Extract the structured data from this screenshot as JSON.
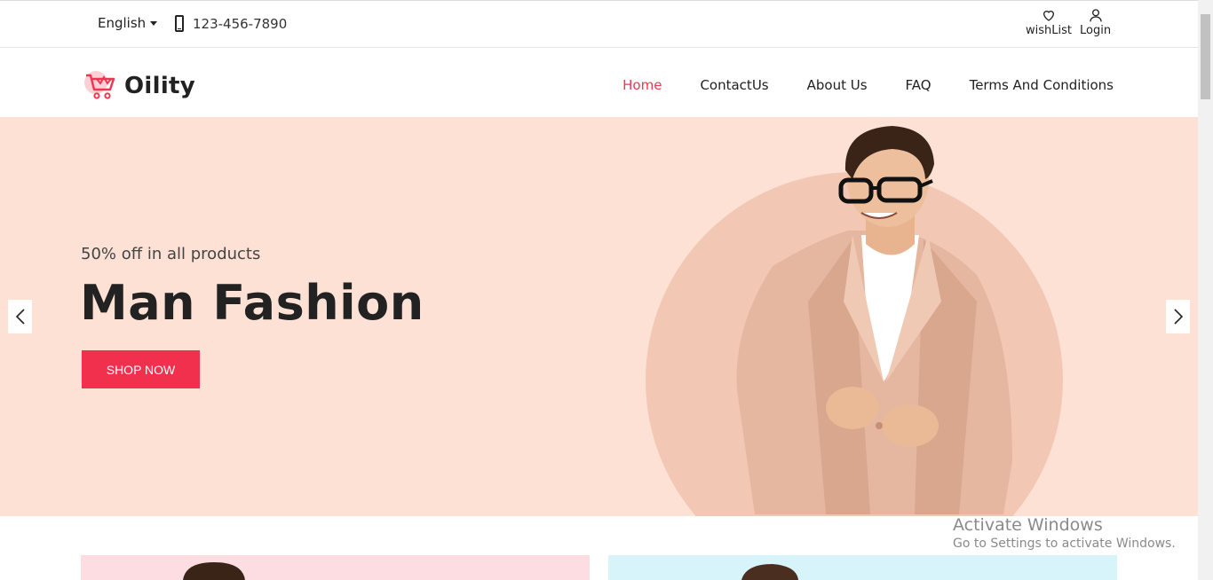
{
  "topbar": {
    "language": "English",
    "phone": "123-456-7890",
    "wishlist_label": "wishList",
    "login_label": "Login"
  },
  "header": {
    "brand": "Oility",
    "nav": [
      {
        "label": "Home",
        "active": true
      },
      {
        "label": "ContactUs",
        "active": false
      },
      {
        "label": "About Us",
        "active": false
      },
      {
        "label": "FAQ",
        "active": false
      },
      {
        "label": "Terms And Conditions",
        "active": false
      }
    ]
  },
  "hero": {
    "subtitle": "50% off in all products",
    "title": "Man Fashion",
    "button_label": "SHOP NOW",
    "prev_icon": "chevron-left-icon",
    "next_icon": "chevron-right-icon"
  },
  "watermark": {
    "title": "Activate Windows",
    "subtitle": "Go to Settings to activate Windows."
  },
  "colors": {
    "accent": "#f0364e",
    "hero_bg": "#fde1d5",
    "card_pink": "#fddde1",
    "card_blue": "#d8f4fb"
  }
}
